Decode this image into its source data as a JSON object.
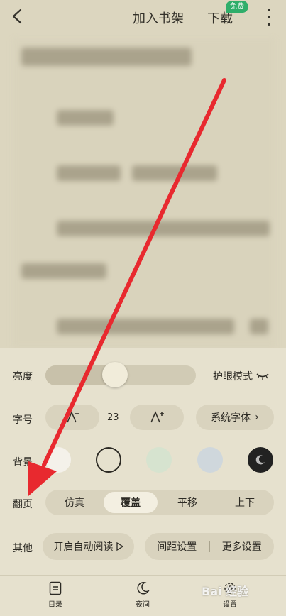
{
  "topbar": {
    "add_shelf": "加入书架",
    "download": "下载",
    "badge": "免费"
  },
  "settings": {
    "brightness": {
      "label": "亮度",
      "value": 0.46,
      "eye_mode": "护眼模式"
    },
    "font_size": {
      "label": "字号",
      "value": "23",
      "system_font": "系统字体",
      "system_font_arrow": "›"
    },
    "background": {
      "label": "背景",
      "colors": [
        "#f4f1ea",
        "#e6e1ce",
        "#d6e3cf",
        "#cfd7dc",
        "#222222"
      ]
    },
    "page_turn": {
      "label": "翻页",
      "options": [
        "仿真",
        "覆盖",
        "平移",
        "上下"
      ],
      "selected": "覆盖"
    },
    "other": {
      "label": "其他",
      "auto_read": "开启自动阅读",
      "spacing": "间距设置",
      "more": "更多设置"
    }
  },
  "bottom_nav": {
    "toc": "目录",
    "night": "夜间",
    "settings": "设置"
  },
  "watermark": "Bai 经验",
  "accent": {
    "arrow": "#e8292f",
    "badge": "#2fae6a"
  }
}
